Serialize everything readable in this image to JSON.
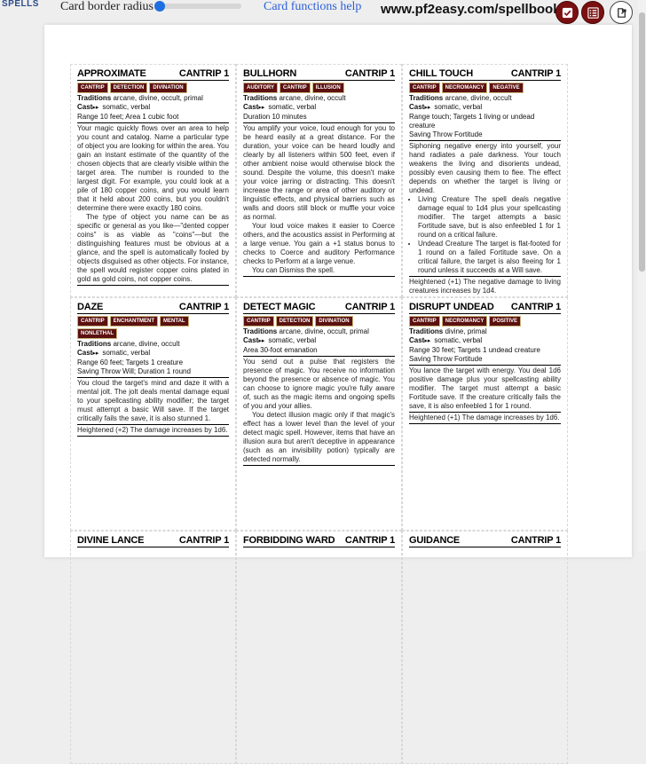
{
  "toolbar": {
    "spells_tag": "SPELLS",
    "card_border_label": "Card border radius",
    "slider_level": 0.0,
    "help_link": "Card functions help",
    "site": "www.pf2easy.com/spellbook"
  },
  "colors": {
    "accent": "#7a1010",
    "trait_bg": "#5c1111",
    "link": "#2b5fd9"
  },
  "cards": [
    {
      "name": "APPROXIMATE",
      "level": "CANTRIP 1",
      "traits": [
        "CANTRIP",
        "DETECTION",
        "DIVINATION"
      ],
      "traditions_label": "Traditions",
      "traditions": "arcane, divine, occult, primal",
      "cast_label": "Cast",
      "cast": "somatic, verbal",
      "line3": "Range 10 feet; Area 1 cubic foot",
      "paragraphs": [
        "Your magic quickly flows over an area to help you count and catalog. Name a particular type of object you are looking for within the area. You gain an instant estimate of the quantity of the chosen objects that are clearly visible within the target area. The number is rounded to the largest digit. For example, you could look at a pile of 180 copper coins, and you would learn that it held about 200 coins, but you couldn't determine there were exactly 180 coins.",
        "The type of object you name can be as specific or general as you like—\"dented copper coins\" is as viable as \"coins\"—but the distinguishing features must be obvious at a glance, and the spell is automatically fooled by objects disguised as other objects. For instance, the spell would register copper coins plated in gold as gold coins, not copper coins."
      ]
    },
    {
      "name": "BULLHORN",
      "level": "CANTRIP 1",
      "traits": [
        "AUDITORY",
        "CANTRIP",
        "ILLUSION"
      ],
      "traditions_label": "Traditions",
      "traditions": "arcane, divine, occult",
      "cast_label": "Cast",
      "cast": "somatic, verbal",
      "line3": "Duration 10 minutes",
      "paragraphs": [
        "You amplify your voice, loud enough for you to be heard easily at a great distance. For the duration, your voice can be heard loudly and clearly by all listeners within 500 feet, even if other ambient noise would otherwise block the sound. Despite the volume, this doesn't make your voice jarring or distracting. This doesn't increase the range or area of other auditory or linguistic effects, and physical barriers such as walls and doors still block or muffle your voice as normal.",
        "Your loud voice makes it easier to Coerce others, and the acoustics assist in Performing at a large venue. You gain a +1 status bonus to checks to Coerce and auditory Performance checks to Perform at a large venue.",
        "You can Dismiss the spell."
      ]
    },
    {
      "name": "CHILL TOUCH",
      "level": "CANTRIP 1",
      "traits": [
        "CANTRIP",
        "NECROMANCY",
        "NEGATIVE"
      ],
      "traditions_label": "Traditions",
      "traditions": "arcane, divine, occult",
      "cast_label": "Cast",
      "cast": "somatic, verbal",
      "line3": "Range touch; Targets 1 living or undead creature",
      "line4": "Saving Throw Fortitude",
      "paragraphs": [
        "Siphoning negative energy into yourself, your hand radiates a pale darkness. Your touch weakens the living and disorients undead, possibly even causing them to flee. The effect depends on whether the target is living or undead."
      ],
      "bullets": [
        "Living Creature The spell deals negative damage equal to 1d4 plus your spellcasting modifier. The target attempts a basic Fortitude save, but is also enfeebled 1 for 1 round on a critical failure.",
        "Undead Creature The target is flat-footed for 1 round on a failed Fortitude save. On a critical failure, the target is also fleeing for 1 round unless it succeeds at a Will save."
      ],
      "heightened": "Heightened (+1) The negative damage to living creatures increases by 1d4."
    },
    {
      "name": "DAZE",
      "level": "CANTRIP 1",
      "traits": [
        "CANTRIP",
        "ENCHANTMENT",
        "MENTAL",
        "NONLETHAL"
      ],
      "traditions_label": "Traditions",
      "traditions": "arcane, divine, occult",
      "cast_label": "Cast",
      "cast": "somatic, verbal",
      "line3": "Range 60 feet; Targets 1 creature",
      "line4": "Saving Throw Will; Duration 1 round",
      "paragraphs": [
        "You cloud the target's mind and daze it with a mental jolt. The jolt deals mental damage equal to your spellcasting ability modifier; the target must attempt a basic Will save. If the target critically fails the save, it is also stunned 1."
      ],
      "heightened": "Heightened (+2) The damage increases by 1d6."
    },
    {
      "name": "DETECT MAGIC",
      "level": "CANTRIP 1",
      "traits": [
        "CANTRIP",
        "DETECTION",
        "DIVINATION"
      ],
      "traditions_label": "Traditions",
      "traditions": "arcane, divine, occult, primal",
      "cast_label": "Cast",
      "cast": "somatic, verbal",
      "line3": "Area 30-foot emanation",
      "paragraphs": [
        "You send out a pulse that registers the presence of magic. You receive no information beyond the presence or absence of magic. You can choose to ignore magic you're fully aware of, such as the magic items and ongoing spells of you and your allies.",
        "You detect illusion magic only if that magic's effect has a lower level than the level of your detect magic spell. However, items that have an illusion aura but aren't deceptive in appearance (such as an invisibility potion) typically are detected normally."
      ]
    },
    {
      "name": "DISRUPT UNDEAD",
      "level": "CANTRIP 1",
      "traits": [
        "CANTRIP",
        "NECROMANCY",
        "POSITIVE"
      ],
      "traditions_label": "Traditions",
      "traditions": "divine, primal",
      "cast_label": "Cast",
      "cast": "somatic, verbal",
      "line3": "Range 30 feet; Targets 1 undead creature",
      "line4": "Saving Throw Fortitude",
      "paragraphs": [
        "You lance the target with energy. You deal 1d6 positive damage plus your spellcasting ability modifier. The target must attempt a basic Fortitude save. If the creature critically fails the save, it is also enfeebled 1 for 1 round."
      ],
      "heightened": "Heightened (+1) The damage increases by 1d6."
    },
    {
      "name": "DIVINE LANCE",
      "level": "CANTRIP 1",
      "traits": []
    },
    {
      "name": "FORBIDDING WARD",
      "level": "CANTRIP 1",
      "traits": []
    },
    {
      "name": "GUIDANCE",
      "level": "CANTRIP 1",
      "traits": []
    }
  ]
}
